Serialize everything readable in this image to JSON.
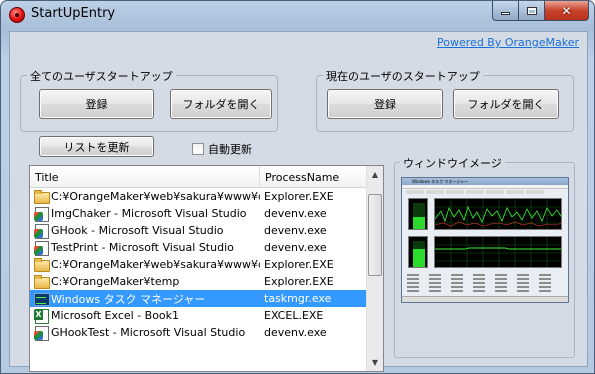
{
  "window": {
    "title": "StartUpEntry",
    "powered_by": "Powered By OrangeMaker"
  },
  "all_users_group": {
    "label": "全てのユーザスタートアップ",
    "register_button": "登録",
    "open_folder_button": "フォルダを開く"
  },
  "current_user_group": {
    "label": "現在のユーザのスタートアップ",
    "register_button": "登録",
    "open_folder_button": "フォルダを開く"
  },
  "refresh_list_button": "リストを更新",
  "auto_refresh": {
    "label": "自動更新",
    "checked": false
  },
  "process_list": {
    "columns": [
      "Title",
      "ProcessName"
    ],
    "rows": [
      {
        "icon": "folder-icon",
        "title": "C:¥OrangeMaker¥web¥sakura¥www¥do…",
        "process": "Explorer.EXE",
        "selected": false
      },
      {
        "icon": "visual-studio-icon",
        "title": "ImgChaker - Microsoft Visual Studio",
        "process": "devenv.exe",
        "selected": false
      },
      {
        "icon": "visual-studio-icon",
        "title": "GHook - Microsoft Visual Studio",
        "process": "devenv.exe",
        "selected": false
      },
      {
        "icon": "visual-studio-icon",
        "title": "TestPrint - Microsoft Visual Studio",
        "process": "devenv.exe",
        "selected": false
      },
      {
        "icon": "folder-icon",
        "title": "C:¥OrangeMaker¥web¥sakura¥www¥do…",
        "process": "Explorer.EXE",
        "selected": false
      },
      {
        "icon": "folder-icon",
        "title": "C:¥OrangeMaker¥temp",
        "process": "Explorer.EXE",
        "selected": false
      },
      {
        "icon": "task-manager-icon",
        "title": "Windows タスク マネージャー",
        "process": "taskmgr.exe",
        "selected": true
      },
      {
        "icon": "excel-icon",
        "title": "Microsoft Excel - Book1",
        "process": "EXCEL.EXE",
        "selected": false
      },
      {
        "icon": "visual-studio-icon",
        "title": "GHookTest - Microsoft Visual Studio",
        "process": "devenv.exe",
        "selected": false
      }
    ],
    "scroll_position": 0.12,
    "scroll_visible_fraction": 0.48
  },
  "preview": {
    "label": "ウィンドウイメージ",
    "thumbnail_title": "Windows タスク マネージャー"
  },
  "colors": {
    "selection": "#3399ff",
    "link": "#1a6fd6",
    "close_button": "#c8432b"
  }
}
